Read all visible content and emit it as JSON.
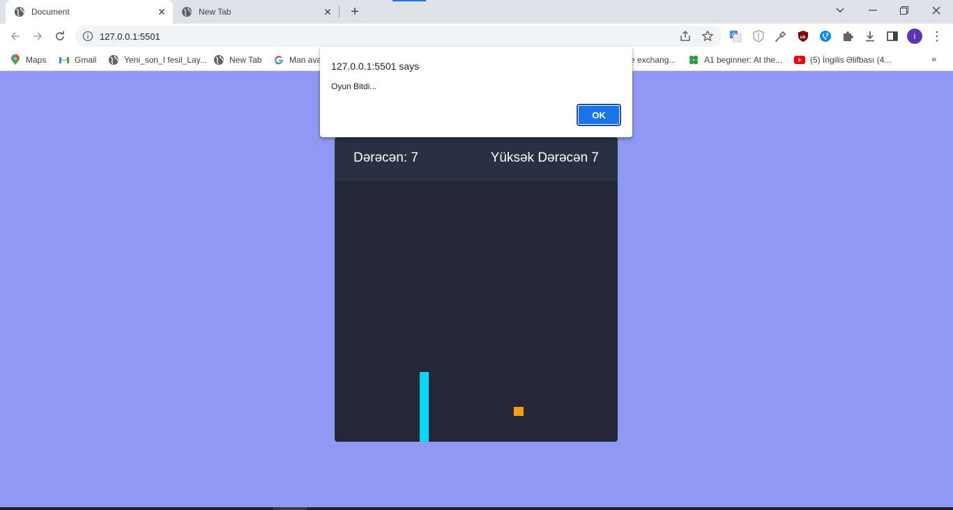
{
  "browser": {
    "tabs": [
      {
        "title": "Document",
        "active": true,
        "close_glyph": "✕"
      },
      {
        "title": "New Tab",
        "active": false,
        "close_glyph": "✕"
      }
    ],
    "new_tab_glyph": "+",
    "window_controls": {
      "minimize": "–",
      "restore": "❐",
      "close": "✕",
      "tab_search": "⌄"
    },
    "address": {
      "url": "127.0.0.1:5501"
    },
    "avatar_letter": "i",
    "extensions": [
      "translate-icon",
      "shield-icon",
      "eyedropper-icon",
      "ublock-icon",
      "shazam-icon",
      "puzzle-icon",
      "download-icon",
      "sidepanel-icon"
    ],
    "menu_glyph": "⋮"
  },
  "bookmarks": {
    "items": [
      {
        "label": "Maps",
        "icon": "maps-icon"
      },
      {
        "label": "Gmail",
        "icon": "gmail-icon"
      },
      {
        "label": "Yeni_son_I fesil_Lay...",
        "icon": "globe-icon"
      },
      {
        "label": "New Tab",
        "icon": "globe-icon"
      },
      {
        "label": "Man ava",
        "icon": "google-icon"
      },
      {
        "label": "e exchang...",
        "icon": "none"
      },
      {
        "label": "A1 beginner: At the...",
        "icon": "clover-icon"
      },
      {
        "label": "(5) İngilis Əlifbası (4...",
        "icon": "youtube-icon"
      }
    ],
    "more_glyph": "»"
  },
  "dialog": {
    "title": "127.0.0.1:5501 says",
    "message": "Oyun Bitdi...",
    "ok_label": "OK"
  },
  "game": {
    "score_label": "Dərəcən: 7",
    "high_score_label": "Yüksək Dərəcən 7",
    "score": 7,
    "high_score": 7,
    "colors": {
      "page_bg": "#8e99f3",
      "board": "#222836",
      "header": "#293242",
      "snake": "#00d9ff",
      "food": "#f5a000"
    }
  }
}
